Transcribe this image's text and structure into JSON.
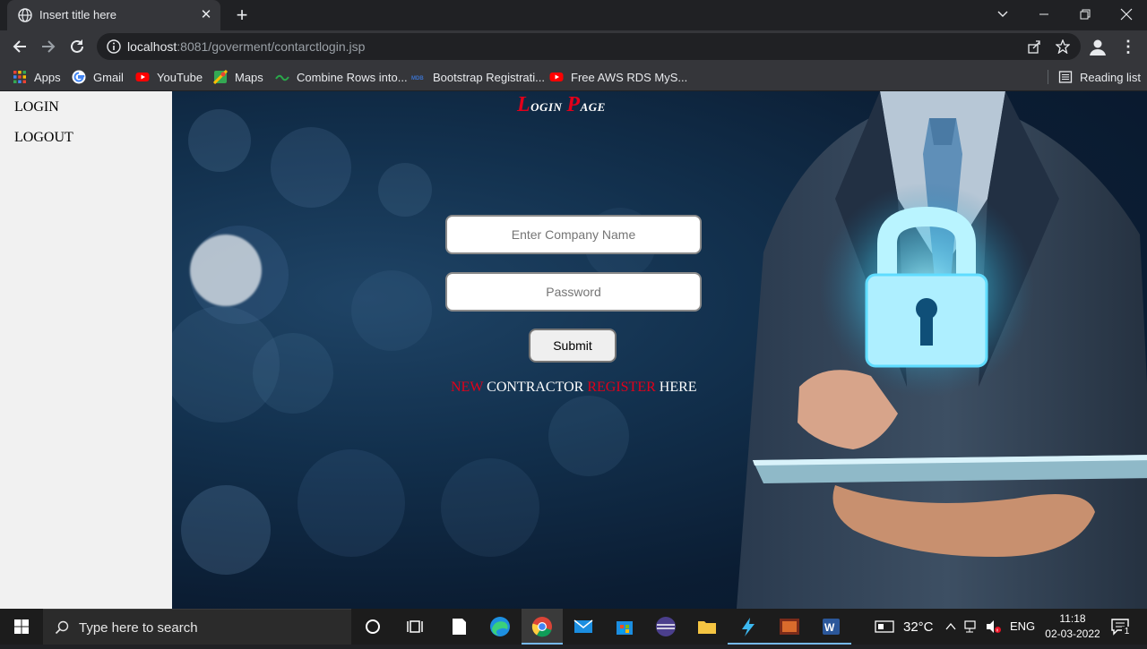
{
  "browser": {
    "tab_title": "Insert title here",
    "url_host": "localhost",
    "url_rest": ":8081/goverment/contarctlogin.jsp",
    "bookmarks": [
      {
        "label": "Apps",
        "icon": "apps-grid-icon"
      },
      {
        "label": "Gmail",
        "icon": "google-icon"
      },
      {
        "label": "YouTube",
        "icon": "youtube-icon"
      },
      {
        "label": "Maps",
        "icon": "maps-icon"
      },
      {
        "label": "Combine Rows into...",
        "icon": "bookmark-site-icon"
      },
      {
        "label": "Bootstrap Registrati...",
        "icon": "mdb-icon"
      },
      {
        "label": "Free AWS RDS MyS...",
        "icon": "youtube-icon"
      }
    ],
    "reading_list": "Reading list"
  },
  "sidebar": {
    "login": "LOGIN",
    "logout": "LOGOUT"
  },
  "login_form": {
    "title_cap1": "L",
    "title_rest1": "ogin",
    "title_cap2": "P",
    "title_rest2": "age",
    "company_placeholder": "Enter Company Name",
    "password_placeholder": "Password",
    "submit_label": "Submit",
    "register_new": "NEW",
    "register_contractor": "CONTRACTOR",
    "register_register": "REGISTER",
    "register_here": "HERE"
  },
  "taskbar": {
    "search_placeholder": "Type here to search",
    "temperature": "32°C",
    "language": "ENG",
    "time": "11:18",
    "date": "02-03-2022",
    "notification_count": "1"
  },
  "colors": {
    "accent_red": "#e2001a",
    "chrome_dark": "#202124",
    "chrome_toolbar": "#35363a"
  }
}
